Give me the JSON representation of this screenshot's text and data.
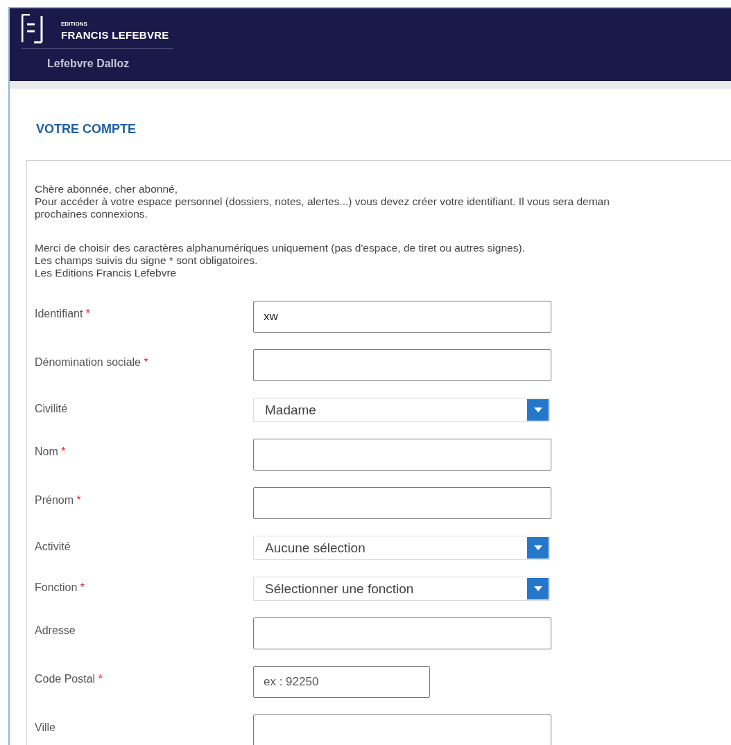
{
  "header": {
    "brand_top": "EDITIONS",
    "brand_name": "FRANCIS LEFEBVRE",
    "sub_brand": "Lefebvre Dalloz"
  },
  "page_title": "VOTRE COMPTE",
  "intro": [
    [
      "Chère abonnée, cher abonné,",
      "Pour accéder à votre espace personnel (dossiers, notes, alertes...) vous devez créer votre identifiant. Il vous sera deman",
      "prochaines connexions."
    ],
    [
      "Merci de choisir des caractères alphanumériques uniquement (pas d'espace, de tiret ou autres signes).",
      "Les champs suivis du signe * sont obligatoires.",
      "Les Editions Francis Lefebvre"
    ]
  ],
  "required_mark": "*",
  "fields": [
    {
      "label": "Identifiant",
      "required": true,
      "kind": "text",
      "value": "xw"
    },
    {
      "label": "Dénomination sociale",
      "required": true,
      "kind": "text"
    },
    {
      "label": "Civilité",
      "required": false,
      "kind": "select",
      "value": "Madame"
    },
    {
      "label": "Nom",
      "required": true,
      "kind": "text"
    },
    {
      "label": "Prénom",
      "required": true,
      "kind": "text"
    },
    {
      "label": "Activité",
      "required": false,
      "kind": "select",
      "value": "Aucune sélection"
    },
    {
      "label": "Fonction",
      "required": true,
      "kind": "select",
      "value": "Sélectionner une fonction"
    },
    {
      "label": "Adresse",
      "required": false,
      "kind": "text"
    },
    {
      "label": "Code Postal",
      "required": true,
      "kind": "short",
      "placeholder": "ex : 92250"
    },
    {
      "label": "Ville",
      "required": false,
      "kind": "text"
    }
  ]
}
